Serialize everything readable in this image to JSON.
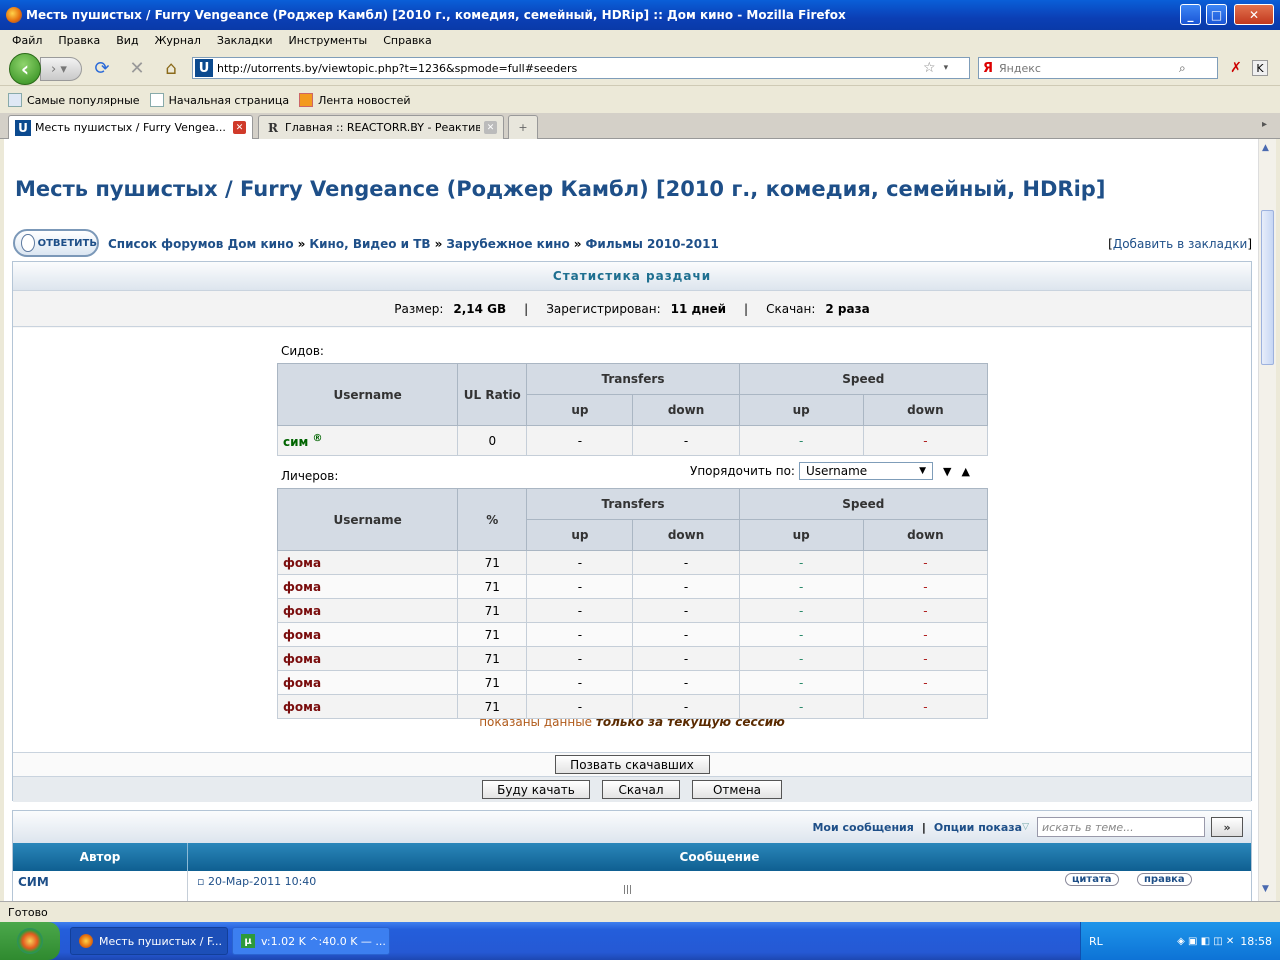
{
  "window": {
    "title": "Месть пушистых / Furry Vengeance (Роджер Камбл) [2010 г., комедия, семейный, HDRip] :: Дом кино - Mozilla Firefox",
    "minimize": "_",
    "maximize": "□",
    "close": "✕"
  },
  "menu": [
    "Файл",
    "Правка",
    "Вид",
    "Журнал",
    "Закладки",
    "Инструменты",
    "Справка"
  ],
  "nav": {
    "url": "http://utorrents.by/viewtopic.php?t=1236&spmode=full#seeders",
    "search_placeholder": "Яндекс",
    "search_engine": "Я",
    "site_icon": "U"
  },
  "bookmarks": [
    "Самые популярные",
    "Начальная страница",
    "Лента новостей"
  ],
  "tabs": [
    {
      "label": "Месть пушистых / Furry Vengea...",
      "icon": "U",
      "active": true
    },
    {
      "label": "Главная :: REACTORR.BY - Реактивн...",
      "icon": "R",
      "active": false
    }
  ],
  "page": {
    "title": "Месть пушистых / Furry Vengeance (Роджер Камбл) [2010 г., комедия, семейный, HDRip]",
    "reply_button": "ОТВЕТИТЬ",
    "breadcrumbs": [
      "Список форумов Дом кино",
      "Кино, Видео и ТВ",
      "Зарубежное кино",
      "Фильмы 2010-2011"
    ],
    "breadcrumb_sep": "»",
    "add_bookmark": "Добавить в закладки",
    "stats": {
      "header": "Статистика раздачи",
      "size_label": "Размер:",
      "size_value": "2,14 GB",
      "registered_label": "Зарегистрирован:",
      "registered_value": "11 дней",
      "downloaded_label": "Скачан:",
      "downloaded_value": "2 раза"
    },
    "seeders": {
      "label": "Сидов:",
      "headers": {
        "username": "Username",
        "ratio": "UL Ratio",
        "transfers": "Transfers",
        "speed": "Speed",
        "up": "up",
        "down": "down"
      },
      "rows": [
        {
          "name": "сим",
          "badge": "®",
          "ratio": "0",
          "t_up": "-",
          "t_down": "-",
          "s_up": "-",
          "s_down": "-"
        }
      ]
    },
    "leechers": {
      "label": "Личеров:",
      "sort_label": "Упорядочить по:",
      "sort_value": "Username",
      "sort_desc": "▼",
      "sort_asc": "▲",
      "headers": {
        "username": "Username",
        "percent": "%",
        "transfers": "Transfers",
        "speed": "Speed",
        "up": "up",
        "down": "down"
      },
      "rows": [
        {
          "name": "фома",
          "pct": "71",
          "t_up": "-",
          "t_down": "-",
          "s_up": "-",
          "s_down": "-"
        },
        {
          "name": "фома",
          "pct": "71",
          "t_up": "-",
          "t_down": "-",
          "s_up": "-",
          "s_down": "-"
        },
        {
          "name": "фома",
          "pct": "71",
          "t_up": "-",
          "t_down": "-",
          "s_up": "-",
          "s_down": "-"
        },
        {
          "name": "фома",
          "pct": "71",
          "t_up": "-",
          "t_down": "-",
          "s_up": "-",
          "s_down": "-"
        },
        {
          "name": "фома",
          "pct": "71",
          "t_up": "-",
          "t_down": "-",
          "s_up": "-",
          "s_down": "-"
        },
        {
          "name": "фома",
          "pct": "71",
          "t_up": "-",
          "t_down": "-",
          "s_up": "-",
          "s_down": "-"
        },
        {
          "name": "фома",
          "pct": "71",
          "t_up": "-",
          "t_down": "-",
          "s_up": "-",
          "s_down": "-"
        }
      ]
    },
    "session_note_prefix": "показаны данные",
    "session_note_emph": "только за текущую сессию",
    "call_downloaders": "Позвать скачавших",
    "will_download": "Буду качать",
    "downloaded_btn": "Скачал",
    "cancel": "Отмена",
    "posts": {
      "my_messages": "Мои сообщения",
      "show_options": "Опции показа",
      "search_placeholder": "искать в теме...",
      "go": "»",
      "col_author": "Автор",
      "col_message": "Сообщение",
      "first_author": "СИМ",
      "first_date": "20-Мар-2011 10:40",
      "quote_btn": "цитата",
      "edit_btn": "правка"
    }
  },
  "statusbar": "Готово",
  "taskbar": {
    "items": [
      {
        "label": "Месть пушистых / F..."
      },
      {
        "label": "v:1.02 K ^:40.0 K — ..."
      }
    ],
    "lang": "RL",
    "clock": "18:58"
  },
  "colors": {
    "link": "#1e4f88",
    "seed": "#006400",
    "leech": "#7a0d0d",
    "header_bg": "#d4dbe4",
    "posts_header": "#0f5f91"
  }
}
